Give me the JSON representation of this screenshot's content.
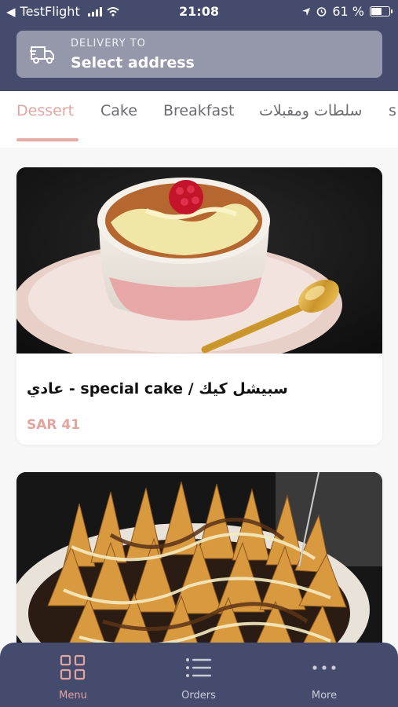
{
  "status_bar": {
    "back_app": "TestFlight",
    "time": "21:08",
    "battery_percent": "61 %",
    "battery_level": 0.61
  },
  "delivery": {
    "label": "DELIVERY TO",
    "value": "Select address",
    "icon": "truck-icon"
  },
  "tabs": [
    {
      "label": "Dessert",
      "active": true
    },
    {
      "label": "Cake",
      "active": false
    },
    {
      "label": "Breakfast",
      "active": false
    },
    {
      "label": "سلطات ومقبلات",
      "active": false
    },
    {
      "label": "s",
      "active": false
    }
  ],
  "products": [
    {
      "name": "عادي - special cake / سبيشل كيك",
      "price": "SAR 41"
    }
  ],
  "bottom_nav": [
    {
      "label": "Menu",
      "icon": "grid-icon",
      "active": true
    },
    {
      "label": "Orders",
      "icon": "list-icon",
      "active": false
    },
    {
      "label": "More",
      "icon": "more-dots-icon",
      "active": false
    }
  ],
  "colors": {
    "header": "#454b6c",
    "accent": "#e3a4a0",
    "delivery_box": "#9598aa"
  }
}
